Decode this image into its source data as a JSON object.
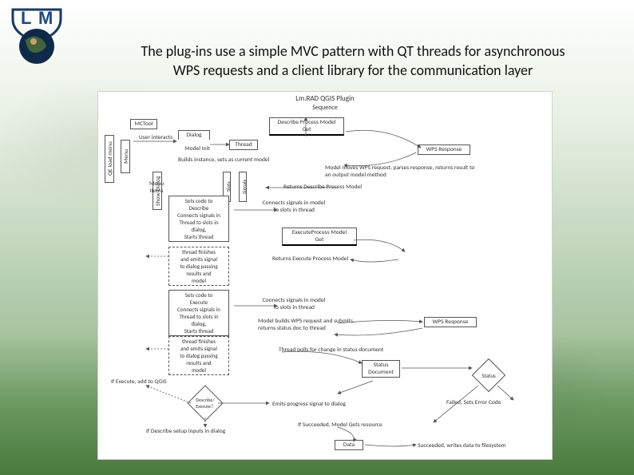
{
  "title_line1": "The plug-ins use a simple MVC pattern with QT threads for asynchronous",
  "title_line2": "WPS requests and a client library for the communication layer",
  "diagram": {
    "header_title": "Lm.RAD QGIS Plugin",
    "header_sub": "Sequence",
    "mctool": "MCTool",
    "qe_loadmenu": "QE load menu",
    "menu": "Menu",
    "dialog": "Dialog",
    "model_init": "Model Init",
    "thread": "Thread",
    "show_dialog": "Show Dialog",
    "slots": "Slots",
    "signals": "Signals",
    "user_interacts": "User interacts",
    "menu_items": "Menu Items",
    "builds_instance": "Builds instance, sets as current model",
    "describe_process_get": "Describe Process Model\nGet",
    "wps_response": "WPS Response",
    "model_resp": "Model moves WPS request, parses response,\nreturns result to an output model method",
    "returns_describe": "Returns Describe Process Model",
    "describe_block": "Sets code to\nDescribe\nConnects signals in\nThread to slots in\ndialog,\nStarts thread",
    "connects_signals": "Connects signals in model\nTo slots in thread",
    "exec_process_get": "ExecuteProcess Model\nGet",
    "returns_exec": "Returns Execute Process Model",
    "thread_finishes1": "thread finishes\nand emits signal\nto dialog passing\nresults and\nmodel",
    "exec_block": "Sets code to\nExecute\nConnects signals in\nThread to slots in\ndialog,\nStarts thread",
    "connects_signals2": "Connects signals in model\nTo slots in thread",
    "model_submits": "Model builds WPS request and submits,\nreturns status doc to thread",
    "wps_response2": "WPS Response",
    "thread_finishes2": "thread finishes\nand emits signal\nto dialog passing\nresults and\nmodel",
    "thread_polls": "Thread polls for change in status document",
    "status_doc": "Status\nDocument",
    "status": "Status",
    "if_execute": "If Execute, add to QGIS",
    "describe_execute": "Describe/\nExecute?",
    "if_describe": "If Describe setup inputs in dialog",
    "emits_progress": "Emits progress signal to dialog",
    "if_succeeded": "If Succeeded, Model Gets resource",
    "failed": "Failed, Sets Error Code",
    "succeeded": "Succeeded, writes data to filesystem",
    "data": "Data"
  }
}
